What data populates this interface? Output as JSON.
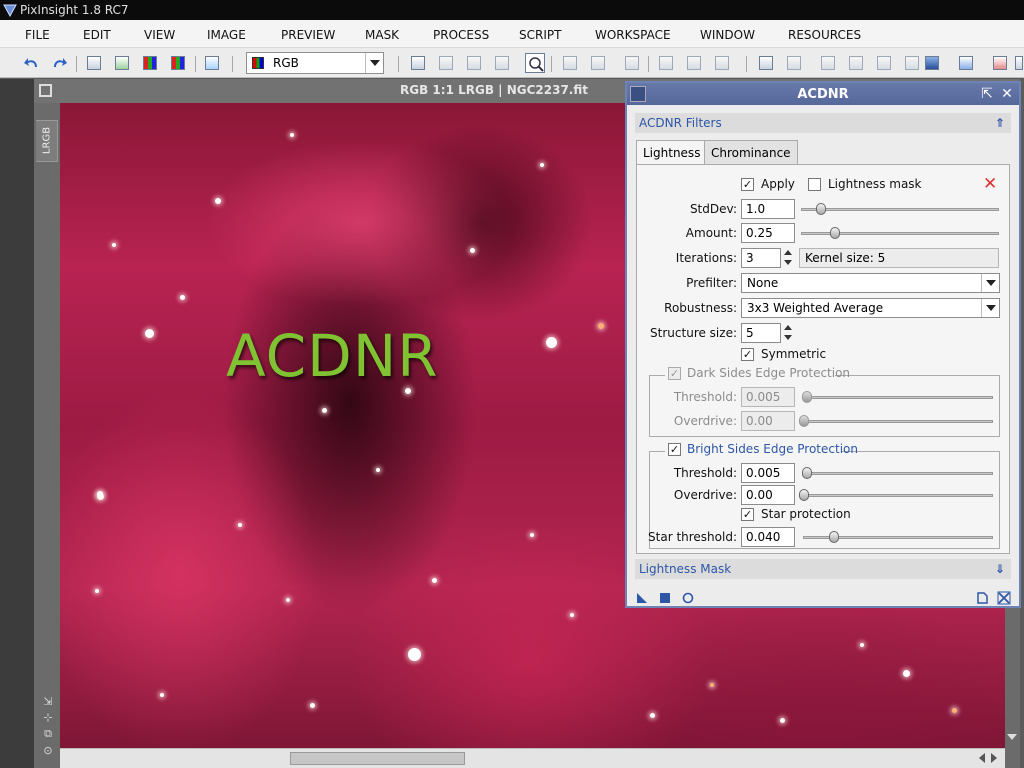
{
  "window": {
    "title": "PixInsight 1.8 RC7"
  },
  "menu": [
    "FILE",
    "EDIT",
    "VIEW",
    "IMAGE",
    "PREVIEW",
    "MASK",
    "PROCESS",
    "SCRIPT",
    "WORKSPACE",
    "WINDOW",
    "RESOURCES"
  ],
  "toolbar": {
    "view_mode": "RGB"
  },
  "image_window": {
    "title": "RGB 1:1 LRGB | NGC2237.fit",
    "side_tab": "LRGB",
    "overlay_text": "ACDNR"
  },
  "acdnr": {
    "title": "ACDNR",
    "filters_section": "ACDNR Filters",
    "tabs": [
      "Lightness",
      "Chrominance"
    ],
    "active_tab": "Lightness",
    "apply_label": "Apply",
    "apply_checked": true,
    "lightness_mask_label": "Lightness mask",
    "lightness_mask_checked": false,
    "stddev": {
      "label": "StdDev:",
      "value": "1.0"
    },
    "amount": {
      "label": "Amount:",
      "value": "0.25"
    },
    "iterations": {
      "label": "Iterations:",
      "value": "3"
    },
    "kernel_size": "Kernel size: 5",
    "prefilter": {
      "label": "Prefilter:",
      "value": "None"
    },
    "robustness": {
      "label": "Robustness:",
      "value": "3x3 Weighted Average"
    },
    "structure_size": {
      "label": "Structure size:",
      "value": "5"
    },
    "symmetric": {
      "label": "Symmetric",
      "checked": true
    },
    "dark_sides": {
      "label": "Dark Sides Edge Protection",
      "checked": true,
      "enabled": false,
      "threshold": {
        "label": "Threshold:",
        "value": "0.005"
      },
      "overdrive": {
        "label": "Overdrive:",
        "value": "0.00"
      }
    },
    "bright_sides": {
      "label": "Bright Sides Edge Protection",
      "checked": true,
      "threshold": {
        "label": "Threshold:",
        "value": "0.005"
      },
      "overdrive": {
        "label": "Overdrive:",
        "value": "0.00"
      },
      "star_protection": {
        "label": "Star protection",
        "checked": true
      },
      "star_threshold": {
        "label": "Star threshold:",
        "value": "0.040"
      }
    },
    "lightness_mask_section": "Lightness Mask",
    "colors": {
      "accent": "#2d56a7",
      "titlebar": "#5a6ba0",
      "close_red": "#d33333"
    }
  }
}
